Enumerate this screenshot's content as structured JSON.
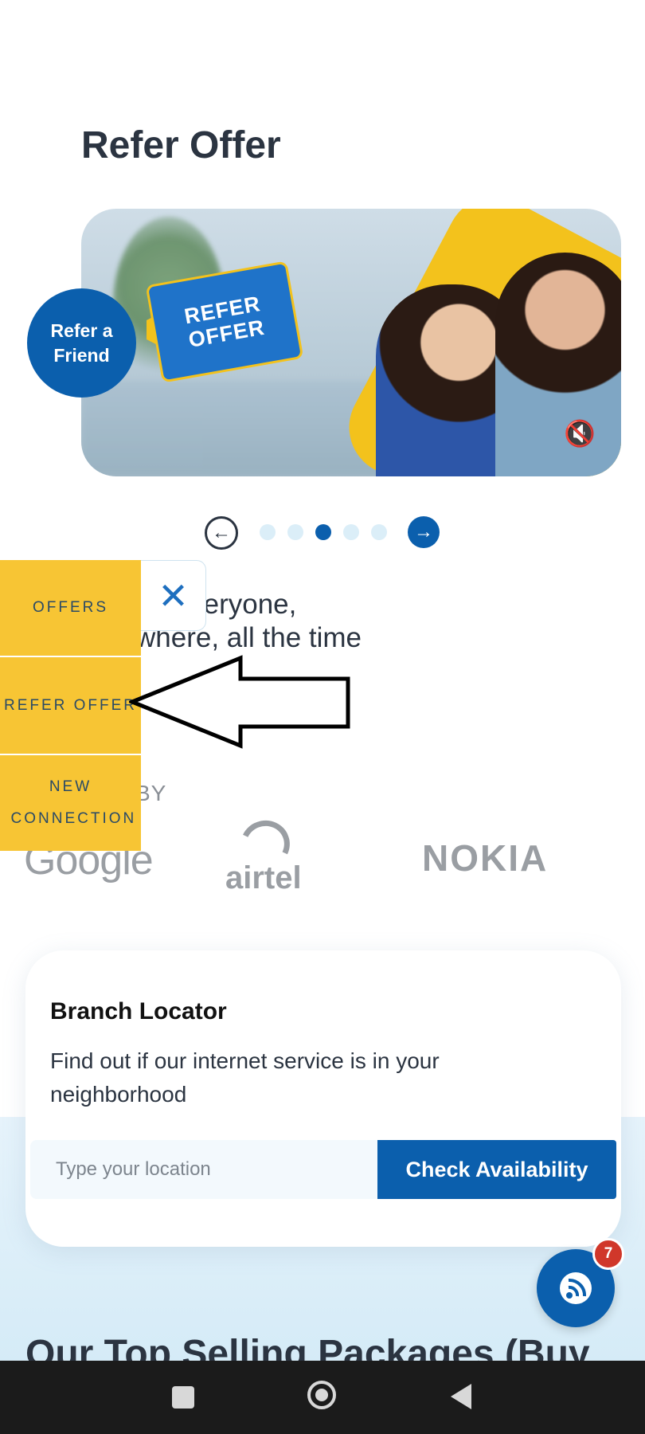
{
  "page_title": "Refer Offer",
  "banner": {
    "badge": "Refer a Friend",
    "tag_line1": "REFER",
    "tag_line2": "OFFER",
    "mute_icon": "volume-mute-icon"
  },
  "carousel": {
    "slide_count": 5,
    "active_index": 2
  },
  "tagline": {
    "line1": "ng everyone,",
    "line2": "where, all the time"
  },
  "trusted_label": "BY",
  "partners": [
    "Google",
    "airtel",
    "NOKIA"
  ],
  "side_menu": {
    "items": [
      "OFFERS",
      "REFER OFFER",
      "NEW CONNECTION"
    ],
    "close_icon": "close-icon"
  },
  "branch_locator": {
    "title": "Branch Locator",
    "description": "Find out if our internet service is in your neighborhood",
    "input_placeholder": "Type your location",
    "button_label": "Check Availability"
  },
  "fab": {
    "icon": "wifi-icon",
    "badge_count": "7"
  },
  "section_heading": "Our Top Selling Packages (Buy",
  "colors": {
    "primary": "#0b5fad",
    "menu_yellow": "#f7c534",
    "text_dark": "#2b3441",
    "badge_red": "#d0372a"
  }
}
